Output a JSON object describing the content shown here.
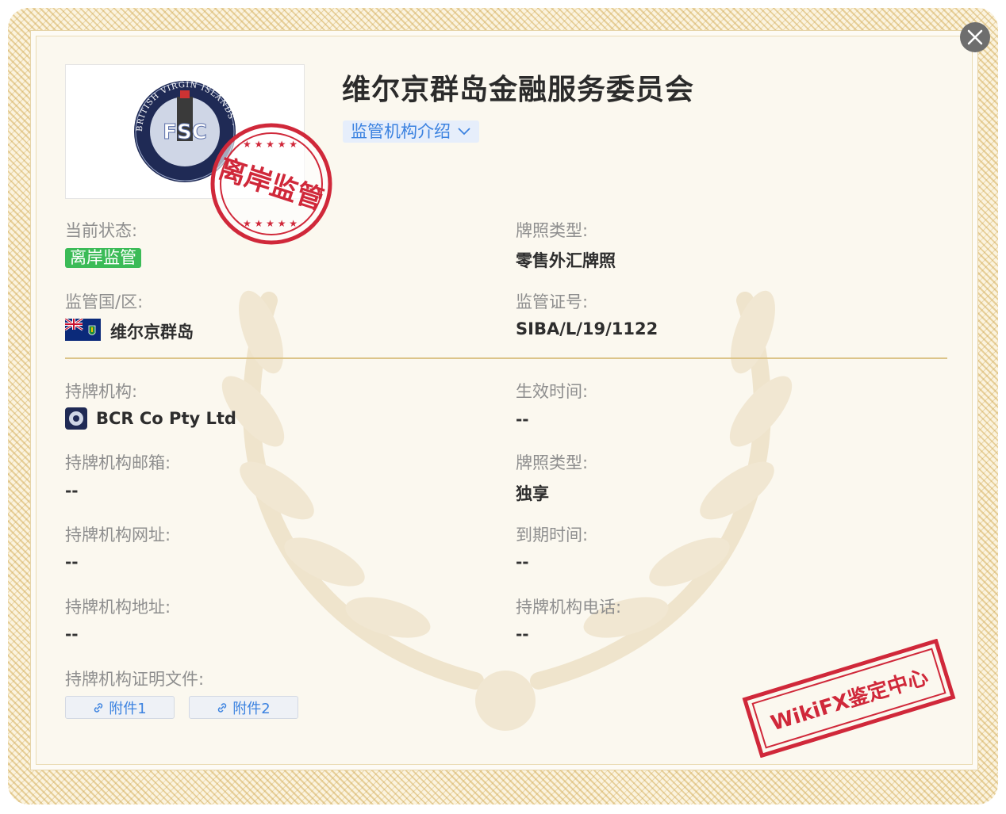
{
  "header": {
    "title": "维尔京群岛金融服务委员会",
    "intro_label": "监管机构介绍"
  },
  "logo": {
    "ring_text": "BRITISH VIRGIN ISLANDS · FINANCIAL SERVICES COMMISSION",
    "mark": "FSC"
  },
  "stamps": {
    "offshore": "离岸监管",
    "wikifx": "WikiFX鉴定中心"
  },
  "fields": {
    "status_label": "当前状态:",
    "status_value": "离岸监管",
    "license_type_label": "牌照类型:",
    "license_type_value": "零售外汇牌照",
    "region_label": "监管国/区:",
    "region_value": "维尔京群岛",
    "license_no_label": "监管证号:",
    "license_no_value": "SIBA/L/19/1122",
    "holder_label": "持牌机构:",
    "holder_value": "BCR Co Pty Ltd",
    "effective_label": "生效时间:",
    "effective_value": "--",
    "email_label": "持牌机构邮箱:",
    "email_value": "--",
    "license_type2_label": "牌照类型:",
    "license_type2_value": "独享",
    "website_label": "持牌机构网址:",
    "website_value": "--",
    "expiry_label": "到期时间:",
    "expiry_value": "--",
    "address_label": "持牌机构地址:",
    "address_value": "--",
    "phone_label": "持牌机构电话:",
    "phone_value": "--",
    "docs_label": "持牌机构证明文件:"
  },
  "attachments": [
    "附件1",
    "附件2"
  ],
  "colors": {
    "accent_blue": "#3b82e0",
    "status_green": "#3bbb57",
    "stamp_red": "#d0283a",
    "gold_border": "#dcc489"
  }
}
